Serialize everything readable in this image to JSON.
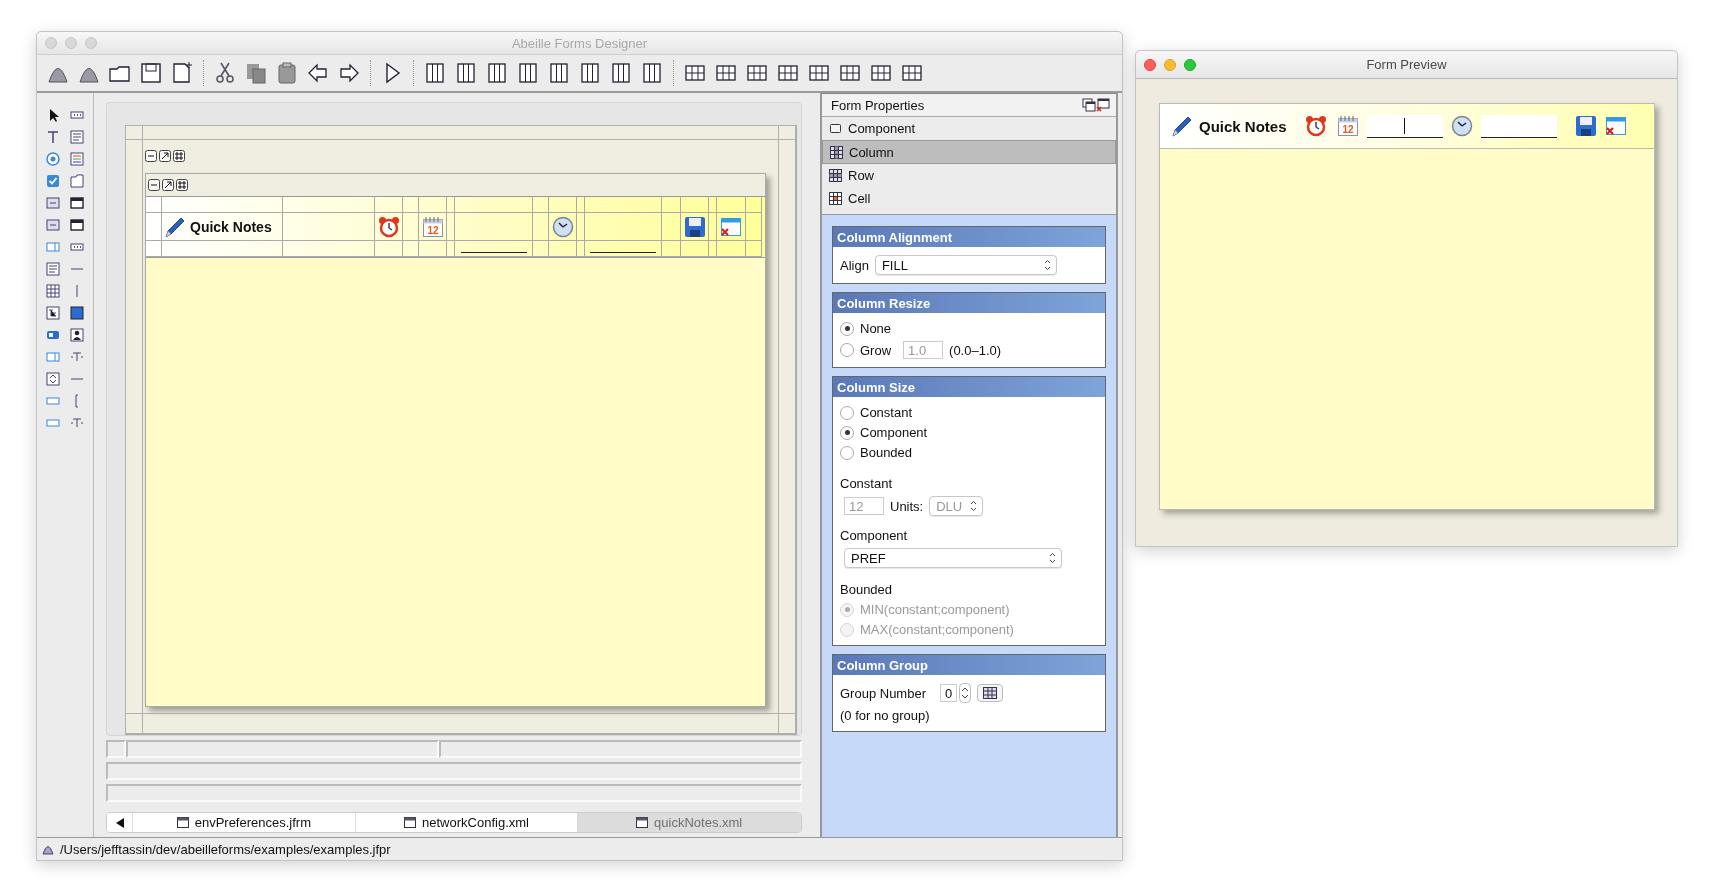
{
  "window": {
    "title": "Abeille Forms Designer",
    "active": false
  },
  "designer": {
    "form": {
      "title": "Quick Notes",
      "calendar_day": "12"
    }
  },
  "file_tabs": [
    {
      "label": "envPreferences.jfrm",
      "selected": false
    },
    {
      "label": "networkConfig.xml",
      "selected": false
    },
    {
      "label": "quickNotes.xml",
      "selected": true
    }
  ],
  "status_bar": {
    "path": "/Users/jefftassin/dev/abeilleforms/examples/examples.jfpr"
  },
  "properties": {
    "title": "Form Properties",
    "sections": [
      {
        "label": "Component",
        "kind": "component",
        "selected": false
      },
      {
        "label": "Column",
        "kind": "column",
        "selected": true
      },
      {
        "label": "Row",
        "kind": "row",
        "selected": false
      },
      {
        "label": "Cell",
        "kind": "cell",
        "selected": false
      }
    ],
    "alignment": {
      "title": "Column Alignment",
      "label": "Align",
      "value": "FILL"
    },
    "resize": {
      "title": "Column Resize",
      "options": [
        {
          "label": "None",
          "selected": true
        },
        {
          "label": "Grow",
          "selected": false
        }
      ],
      "grow_value": "1.0",
      "grow_range": "(0.0–1.0)"
    },
    "size": {
      "title": "Column Size",
      "options": [
        {
          "label": "Constant",
          "selected": false
        },
        {
          "label": "Component",
          "selected": true
        },
        {
          "label": "Bounded",
          "selected": false
        }
      ],
      "constant_label": "Constant",
      "constant_value": "12",
      "units_label": "Units:",
      "units_value": "DLU",
      "component_label": "Component",
      "component_value": "PREF",
      "bounded_label": "Bounded",
      "bounded_options": [
        {
          "label": "MIN(constant;component)",
          "selected": true,
          "disabled": true
        },
        {
          "label": "MAX(constant;component)",
          "selected": false,
          "disabled": true
        }
      ]
    },
    "group": {
      "title": "Column Group",
      "label": "Group Number",
      "value": "0",
      "hint": "(0 for no group)"
    }
  },
  "preview": {
    "title": "Form Preview",
    "active": true,
    "form": {
      "title": "Quick Notes",
      "calendar_day": "12",
      "fields": [
        {
          "focused": true
        },
        {
          "focused": false
        }
      ]
    }
  }
}
